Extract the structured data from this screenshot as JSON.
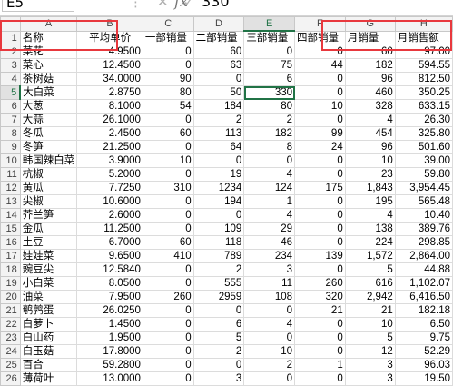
{
  "formula_bar": {
    "name_box": "E5",
    "icons": [
      "more-icon",
      "cancel-icon",
      "confirm-icon"
    ],
    "fx": "fx",
    "value": "330"
  },
  "columns": [
    "A",
    "B",
    "C",
    "D",
    "E",
    "F",
    "G",
    "H"
  ],
  "active_cell": {
    "column": "E",
    "row": "5"
  },
  "highlight_color": "#e8383d",
  "accent_color": "#217346",
  "header_row": [
    "名称",
    "平均单价",
    "一部销量",
    "二部销量",
    "三部销量",
    "四部销量",
    "月销量",
    "月销售额"
  ],
  "rows": [
    {
      "n": "2",
      "c": [
        "菜花",
        "4.9500",
        "0",
        "60",
        "0",
        "0",
        "60",
        "97.00"
      ]
    },
    {
      "n": "3",
      "c": [
        "菜心",
        "12.4500",
        "0",
        "63",
        "75",
        "44",
        "182",
        "594.55"
      ]
    },
    {
      "n": "4",
      "c": [
        "茶树菇",
        "34.0000",
        "90",
        "0",
        "6",
        "0",
        "96",
        "812.50"
      ]
    },
    {
      "n": "5",
      "c": [
        "大白菜",
        "2.8750",
        "80",
        "50",
        "330",
        "0",
        "460",
        "350.25"
      ]
    },
    {
      "n": "6",
      "c": [
        "大葱",
        "8.1000",
        "54",
        "184",
        "80",
        "10",
        "328",
        "633.15"
      ]
    },
    {
      "n": "7",
      "c": [
        "大蒜",
        "26.1000",
        "0",
        "2",
        "2",
        "0",
        "4",
        "26.30"
      ]
    },
    {
      "n": "8",
      "c": [
        "冬瓜",
        "2.4500",
        "60",
        "113",
        "182",
        "99",
        "454",
        "325.80"
      ]
    },
    {
      "n": "9",
      "c": [
        "冬笋",
        "21.2500",
        "0",
        "64",
        "8",
        "24",
        "96",
        "501.60"
      ]
    },
    {
      "n": "10",
      "c": [
        "韩国辣白菜",
        "3.9000",
        "10",
        "0",
        "0",
        "0",
        "10",
        "39.00"
      ]
    },
    {
      "n": "11",
      "c": [
        "杭椒",
        "5.2000",
        "0",
        "19",
        "4",
        "0",
        "23",
        "59.80"
      ]
    },
    {
      "n": "12",
      "c": [
        "黄瓜",
        "7.7250",
        "310",
        "1234",
        "124",
        "175",
        "1,843",
        "3,954.45"
      ]
    },
    {
      "n": "13",
      "c": [
        "尖椒",
        "10.6000",
        "0",
        "194",
        "1",
        "0",
        "195",
        "565.48"
      ]
    },
    {
      "n": "14",
      "c": [
        "芥兰笋",
        "2.6000",
        "0",
        "0",
        "4",
        "0",
        "4",
        "10.40"
      ]
    },
    {
      "n": "15",
      "c": [
        "金瓜",
        "11.2500",
        "0",
        "109",
        "29",
        "0",
        "138",
        "389.76"
      ]
    },
    {
      "n": "16",
      "c": [
        "土豆",
        "6.7000",
        "60",
        "118",
        "46",
        "0",
        "224",
        "298.85"
      ]
    },
    {
      "n": "17",
      "c": [
        "娃娃菜",
        "9.6500",
        "410",
        "789",
        "234",
        "139",
        "1,572",
        "2,864.00"
      ]
    },
    {
      "n": "18",
      "c": [
        "豌豆尖",
        "12.5840",
        "0",
        "2",
        "3",
        "0",
        "5",
        "44.88"
      ]
    },
    {
      "n": "19",
      "c": [
        "小白菜",
        "8.0500",
        "0",
        "555",
        "11",
        "260",
        "616",
        "1,102.07"
      ]
    },
    {
      "n": "20",
      "c": [
        "油菜",
        "7.9500",
        "260",
        "2959",
        "108",
        "320",
        "2,942",
        "6,416.50"
      ]
    },
    {
      "n": "21",
      "c": [
        "鹌鹑蛋",
        "26.0250",
        "0",
        "0",
        "0",
        "21",
        "21",
        "182.18"
      ]
    },
    {
      "n": "22",
      "c": [
        "白萝卜",
        "1.4500",
        "0",
        "6",
        "4",
        "0",
        "10",
        "6.50"
      ]
    },
    {
      "n": "23",
      "c": [
        "白山药",
        "1.9500",
        "0",
        "5",
        "0",
        "0",
        "5",
        "9.75"
      ]
    },
    {
      "n": "24",
      "c": [
        "白玉菇",
        "17.8000",
        "0",
        "2",
        "10",
        "0",
        "12",
        "52.29"
      ]
    },
    {
      "n": "25",
      "c": [
        "百合",
        "59.2800",
        "0",
        "0",
        "2",
        "1",
        "3",
        "96.03"
      ]
    },
    {
      "n": "26",
      "c": [
        "薄荷叶",
        "13.0000",
        "0",
        "3",
        "0",
        "0",
        "3",
        "19.50"
      ]
    }
  ]
}
